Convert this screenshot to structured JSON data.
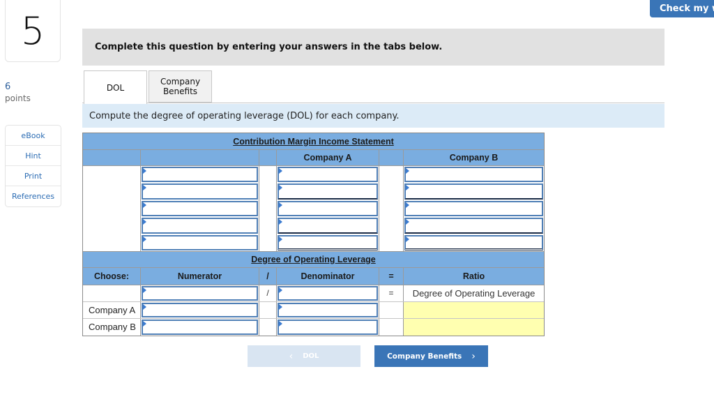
{
  "question": {
    "number": "5",
    "points_value": "6",
    "points_label": "points"
  },
  "tools": [
    {
      "label": "eBook",
      "icon": "ebook"
    },
    {
      "label": "Hint",
      "icon": "hint"
    },
    {
      "label": "Print",
      "icon": "print"
    },
    {
      "label": "References",
      "icon": "references"
    }
  ],
  "header": {
    "check_button": "Check my work"
  },
  "banner": "Complete this question by entering your answers in the tabs below.",
  "tabs": [
    {
      "label": "DOL",
      "active": true
    },
    {
      "label": "Company Benefits",
      "active": false
    }
  ],
  "prompt": "Compute the degree of operating leverage (DOL) for each company.",
  "income_statement": {
    "title": "Contribution Margin Income Statement",
    "columns": [
      "",
      "",
      "",
      "Company A",
      "",
      "Company B"
    ],
    "rows": [
      {
        "label": "",
        "company_a": "",
        "company_b": ""
      },
      {
        "label": "",
        "company_a": "",
        "company_b": ""
      },
      {
        "label": "",
        "company_a": "",
        "company_b": ""
      },
      {
        "label": "",
        "company_a": "",
        "company_b": ""
      },
      {
        "label": "",
        "company_a": "",
        "company_b": ""
      }
    ]
  },
  "dol_table": {
    "title": "Degree of Operating Leverage",
    "columns": [
      "Choose:",
      "Numerator",
      "/",
      "Denominator",
      "=",
      "Ratio"
    ],
    "formula_row": {
      "divide": "/",
      "equals": "=",
      "ratio_label": "Degree of Operating Leverage"
    },
    "rows": [
      {
        "label": "Company A",
        "numerator": "",
        "denominator": "",
        "ratio": ""
      },
      {
        "label": "Company B",
        "numerator": "",
        "denominator": "",
        "ratio": ""
      }
    ]
  },
  "navigation": {
    "prev_label": "DOL",
    "next_label": "Company Benefits",
    "prev_icon": "chevron-left",
    "next_icon": "chevron-right"
  },
  "colors": {
    "accent": "#3a75b7",
    "table_header": "#7aade0",
    "prompt_bg": "#dcebf7",
    "answer_cell": "#ffffb0"
  }
}
